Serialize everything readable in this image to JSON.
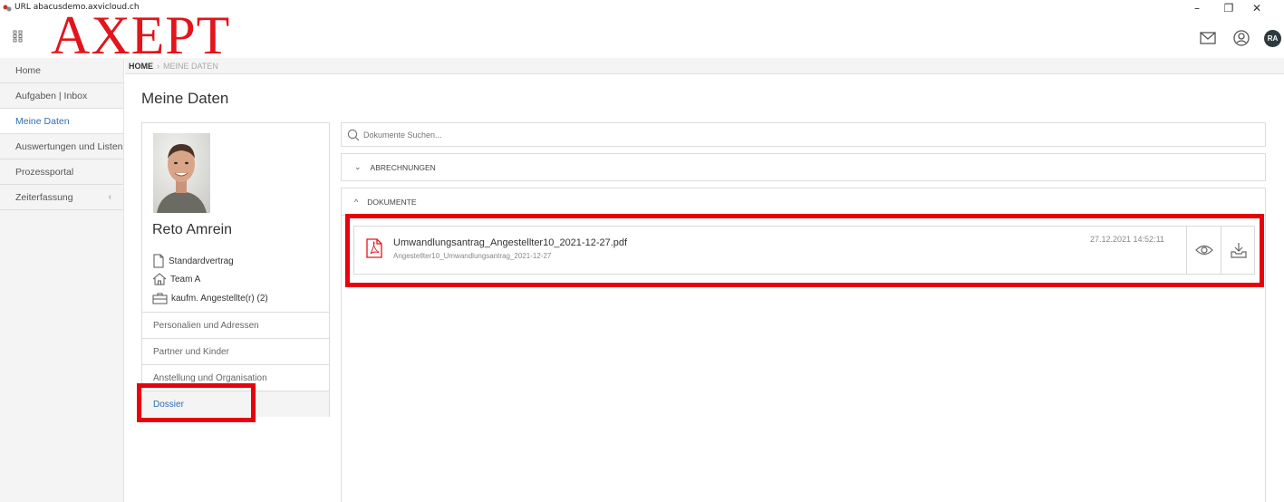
{
  "window": {
    "url_text": "URL abacusdemo.axvicloud.ch",
    "minimize": "–",
    "maximize": "❐",
    "close": "✕"
  },
  "header": {
    "logo": "AXEPT",
    "avatar_initials": "RA",
    "icons": [
      "apps-grid-icon",
      "mail-icon",
      "user-circle-icon"
    ]
  },
  "sidebar": {
    "items": [
      {
        "label": "Home"
      },
      {
        "label": "Aufgaben | Inbox"
      },
      {
        "label": "Meine Daten"
      },
      {
        "label": "Auswertungen und Listen"
      },
      {
        "label": "Prozessportal"
      },
      {
        "label": "Zeiterfassung",
        "chevron": "‹"
      }
    ]
  },
  "breadcrumb": {
    "home": "HOME",
    "separator": "›",
    "current": "MEINE DATEN"
  },
  "page": {
    "title": "Meine Daten"
  },
  "profile": {
    "name": "Reto Amrein",
    "contract": "Standardvertrag",
    "team": "Team A",
    "role": "kaufm. Angestellte(r) (2)",
    "menu": [
      {
        "label": "Personalien und Adressen"
      },
      {
        "label": "Partner und Kinder"
      },
      {
        "label": "Anstellung und Organisation"
      },
      {
        "label": "Dossier"
      }
    ]
  },
  "search": {
    "placeholder": "Dokumente Suchen..."
  },
  "sections": {
    "abrechnungen": {
      "label": "ABRECHNUNGEN",
      "arrow": "⌄"
    },
    "dokumente": {
      "label": "DOKUMENTE",
      "arrow": "^"
    }
  },
  "document": {
    "filename": "Umwandlungsantrag_Angestellter10_2021-12-27.pdf",
    "subtitle": "Angestellter10_Umwandlungsantrag_2021-12-27",
    "date": "27.12.2021 14:52:11",
    "icons": [
      "pdf-icon",
      "eye-icon",
      "download-icon"
    ]
  },
  "colors": {
    "brand_red": "#e3141b",
    "highlight_red": "#e8000d",
    "active_blue": "#2d6fb5"
  }
}
